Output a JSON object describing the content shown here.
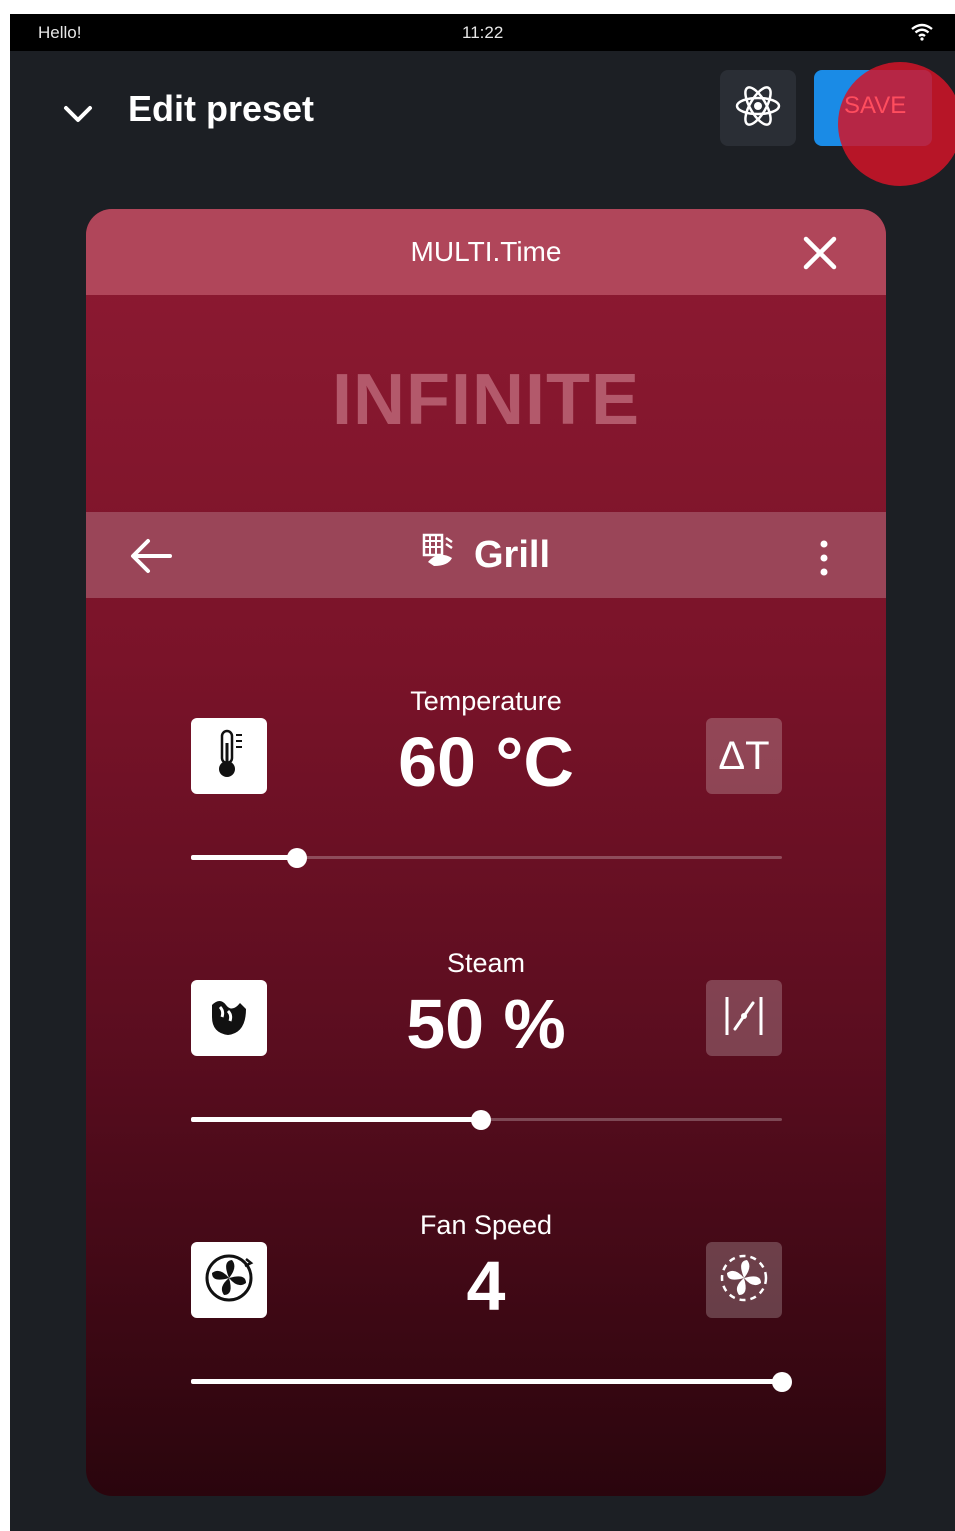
{
  "statusbar": {
    "left": "Hello!",
    "time": "11:22"
  },
  "header": {
    "title": "Edit preset",
    "save_label": "SAVE"
  },
  "card": {
    "title": "MULTI.Time",
    "time_display": "INFINITE",
    "program": {
      "name": "Grill"
    }
  },
  "params": {
    "temperature": {
      "label": "Temperature",
      "value": "60 °C",
      "right_button": "ΔT",
      "level": 0.18
    },
    "steam": {
      "label": "Steam",
      "value": "50 %",
      "level": 0.49
    },
    "fan": {
      "label": "Fan Speed",
      "value": "4",
      "level": 1.0
    }
  },
  "colors": {
    "accent_blue": "#1a8be6",
    "card_header": "#b0465a",
    "card_top": "#8e1a32"
  },
  "icons": {
    "collapse": "chevron-down-icon",
    "atom": "atom-icon",
    "close": "close-icon",
    "back": "arrow-left-icon",
    "program": "grill-icon",
    "more": "more-vertical-icon",
    "temperature": "thermometer-icon",
    "delta_t": "delta-t-icon",
    "steam": "steam-icon",
    "steam_right": "steam-valve-icon",
    "fan": "fan-icon",
    "fan_right": "fan-auto-icon",
    "wifi": "wifi-icon"
  }
}
